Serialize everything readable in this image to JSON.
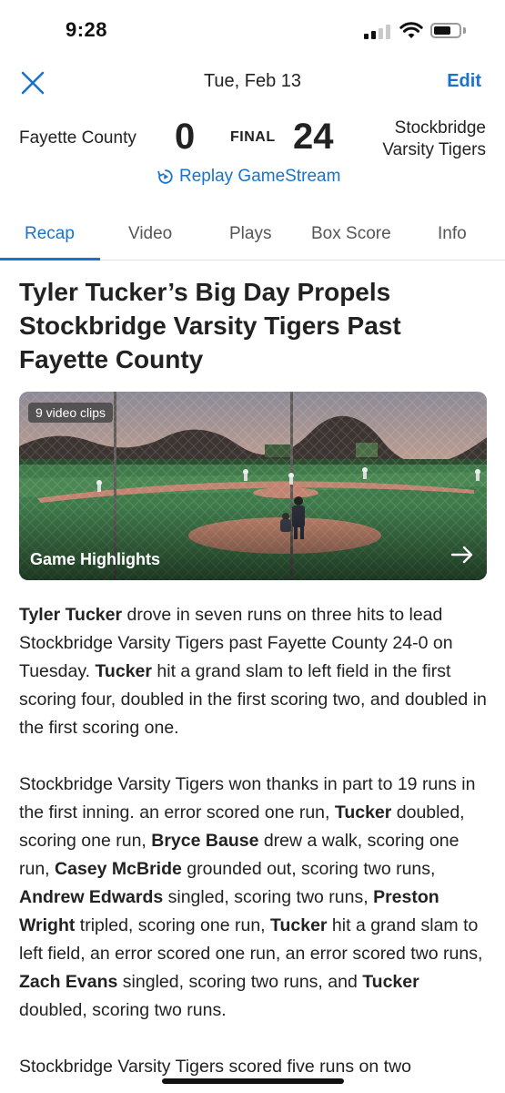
{
  "status_bar": {
    "time": "9:28",
    "icons": [
      "cellular-signal-icon",
      "wifi-icon",
      "battery-icon"
    ]
  },
  "header": {
    "close_icon": "close-icon",
    "date": "Tue, Feb 13",
    "edit_label": "Edit"
  },
  "scoreboard": {
    "away_team": "Fayette County",
    "away_score": "0",
    "status": "FINAL",
    "home_score": "24",
    "home_team_line1": "Stockbridge",
    "home_team_line2": "Varsity Tigers",
    "replay_label": "Replay GameStream",
    "replay_icon": "replay-icon"
  },
  "tabs": [
    {
      "label": "Recap",
      "active": true
    },
    {
      "label": "Video",
      "active": false
    },
    {
      "label": "Plays",
      "active": false
    },
    {
      "label": "Box Score",
      "active": false
    },
    {
      "label": "Info",
      "active": false
    }
  ],
  "article": {
    "headline": "Tyler Tucker’s Big Day Propels Stockbridge Varsity Tigers Past Fayette County",
    "video": {
      "clips_badge": "9 video clips",
      "title": "Game Highlights",
      "arrow_icon": "arrow-right-icon"
    },
    "paragraphs": [
      [
        {
          "text": "Tyler Tucker",
          "bold": true
        },
        {
          "text": " drove in seven runs on three hits to lead Stockbridge Varsity Tigers past Fayette County 24-0 on Tuesday. ",
          "bold": false
        },
        {
          "text": "Tucker",
          "bold": true
        },
        {
          "text": " hit a grand slam to left field in the first scoring four, doubled in the first scoring two, and doubled in the first scoring one.",
          "bold": false
        }
      ],
      [
        {
          "text": "Stockbridge Varsity Tigers won thanks in part to 19 runs in the first inning.  an error scored one run, ",
          "bold": false
        },
        {
          "text": "Tucker",
          "bold": true
        },
        {
          "text": " doubled, scoring one run, ",
          "bold": false
        },
        {
          "text": "Bryce Bause",
          "bold": true
        },
        {
          "text": " drew a walk, scoring one run, ",
          "bold": false
        },
        {
          "text": "Casey McBride",
          "bold": true
        },
        {
          "text": " grounded out, scoring two runs, ",
          "bold": false
        },
        {
          "text": "Andrew Edwards",
          "bold": true
        },
        {
          "text": " singled, scoring two runs, ",
          "bold": false
        },
        {
          "text": "Preston Wright",
          "bold": true
        },
        {
          "text": " tripled, scoring one run, ",
          "bold": false
        },
        {
          "text": "Tucker",
          "bold": true
        },
        {
          "text": " hit a grand slam to left field, an error scored one run, an error scored two runs, ",
          "bold": false
        },
        {
          "text": "Zach Evans",
          "bold": true
        },
        {
          "text": " singled, scoring two runs, and ",
          "bold": false
        },
        {
          "text": "Tucker",
          "bold": true
        },
        {
          "text": " doubled, scoring two runs.",
          "bold": false
        }
      ],
      [
        {
          "text": "Stockbridge Varsity Tigers scored five runs on two",
          "bold": false
        }
      ]
    ]
  },
  "colors": {
    "accent": "#1a73c8",
    "text": "#222222",
    "divider": "#e2e2e2"
  }
}
